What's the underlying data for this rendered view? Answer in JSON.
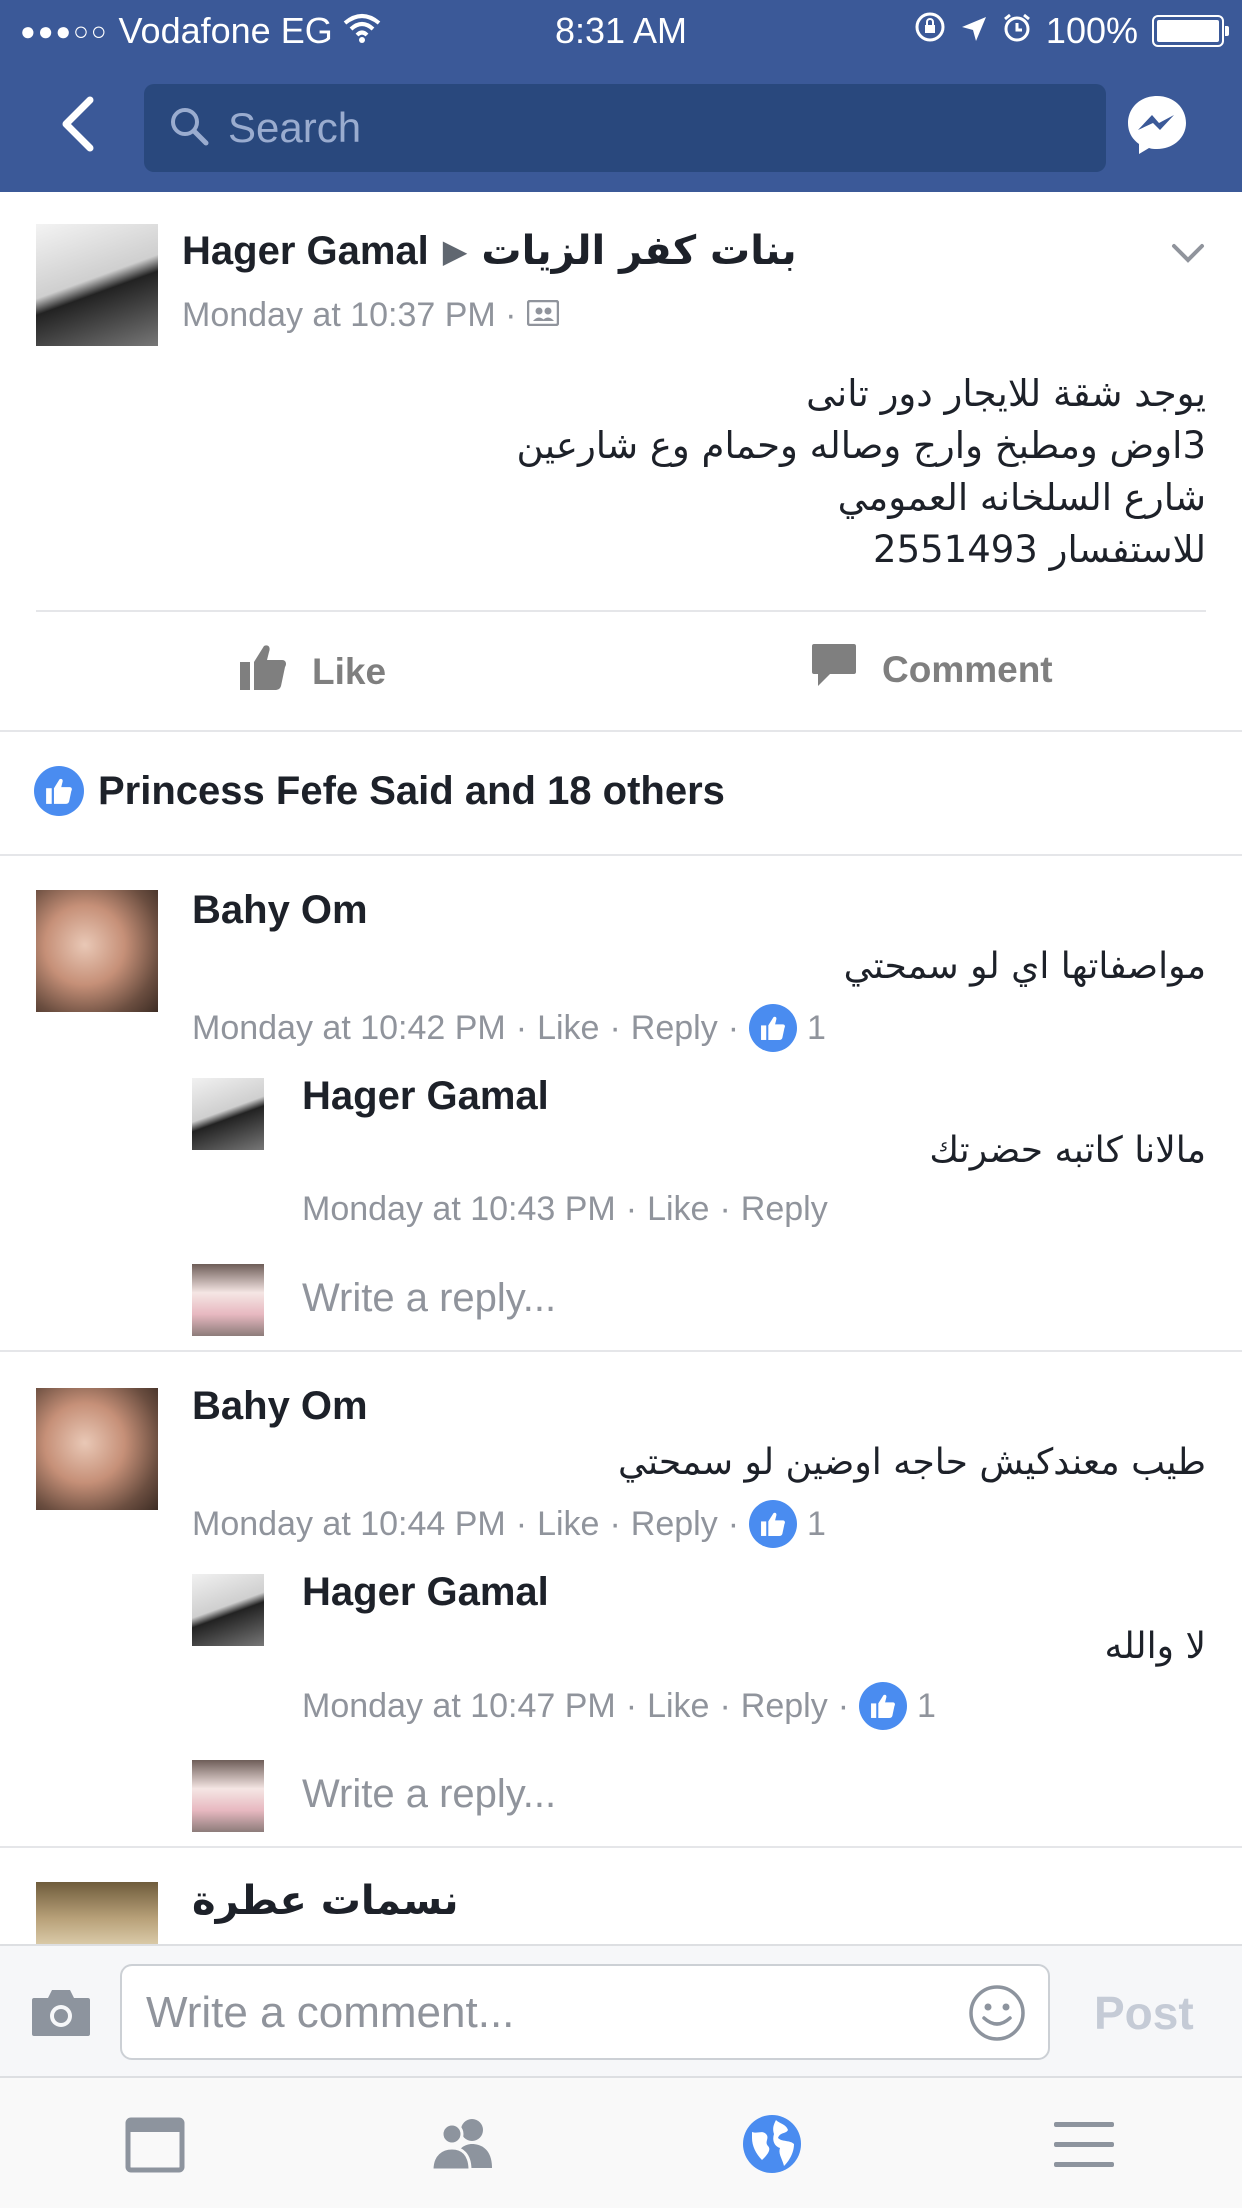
{
  "status_bar": {
    "signal": "●●●○○",
    "carrier": "Vodafone EG",
    "time": "8:31 AM",
    "battery": "100%",
    "battery_level": 1.0
  },
  "nav": {
    "search_placeholder": "Search"
  },
  "post": {
    "author": "Hager Gamal",
    "group": "بنات كفر الزيات",
    "timestamp": "Monday at 10:37 PM ·",
    "lines": [
      "يوجد شقة للايجار دور تانى",
      "3اوض ومطبخ وارج وصاله وحمام وع شارعين",
      "شارع السلخانه العمومي",
      "للاستفسار 2551493"
    ]
  },
  "actions": {
    "like": "Like",
    "comment": "Comment"
  },
  "likes_summary": "Princess Fefe Said and 18 others",
  "comments": [
    {
      "name": "Bahy Om",
      "text": "مواصفاتها اي لو سمحتي",
      "time": "Monday at 10:42 PM",
      "like": "Like",
      "reply": "Reply",
      "reactions": "1",
      "replies": [
        {
          "name": "Hager Gamal",
          "text": "مالانا كاتبه حضرتك",
          "time": "Monday at 10:43 PM",
          "like": "Like",
          "reply": "Reply"
        }
      ],
      "reply_placeholder": "Write a reply..."
    },
    {
      "name": "Bahy Om",
      "text": "طيب  معندكيش حاجه اوضين لو سمحتي",
      "time": "Monday at 10:44 PM",
      "like": "Like",
      "reply": "Reply",
      "reactions": "1",
      "replies": [
        {
          "name": "Hager Gamal",
          "text": "لا والله",
          "time": "Monday at 10:47 PM",
          "like": "Like",
          "reply": "Reply",
          "reactions": "1"
        }
      ],
      "reply_placeholder": "Write a reply..."
    },
    {
      "name": "نسمات عطرة"
    }
  ],
  "composer": {
    "placeholder": "Write a comment...",
    "post": "Post"
  },
  "colors": {
    "brand": "#3b5998",
    "search_bg": "#29487d",
    "like_blue": "#4a8cf0",
    "meta_gray": "#90949c"
  }
}
